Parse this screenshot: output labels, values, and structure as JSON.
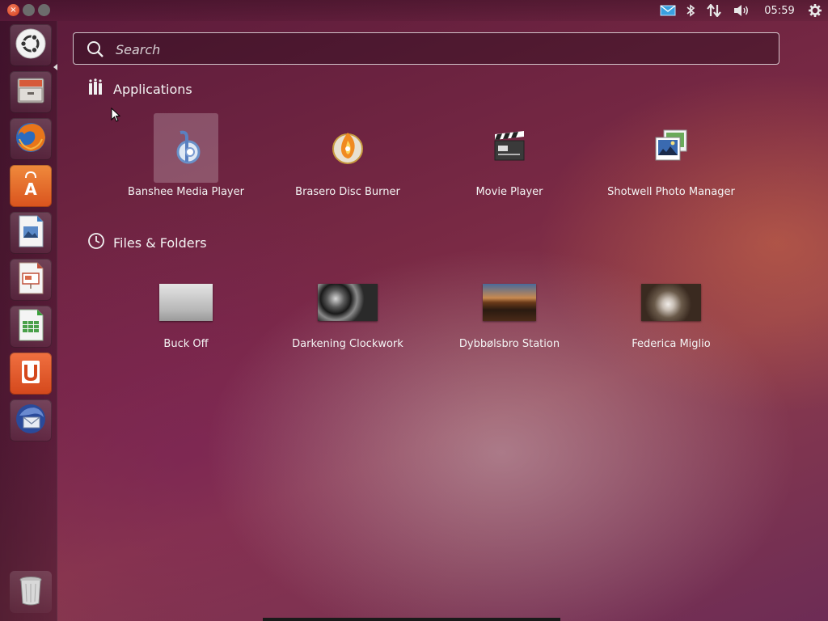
{
  "panel": {
    "clock": "05:59",
    "tray_icons": [
      "mail-icon",
      "bluetooth-icon",
      "network-icon",
      "volume-icon",
      "gear-icon"
    ]
  },
  "launcher": {
    "items": [
      {
        "name": "dash-home",
        "icon": "ubuntu-logo-icon"
      },
      {
        "name": "files",
        "icon": "file-cabinet-icon"
      },
      {
        "name": "firefox",
        "icon": "firefox-icon"
      },
      {
        "name": "software-center",
        "icon": "shopping-bag-icon"
      },
      {
        "name": "libreoffice-writer",
        "icon": "writer-document-icon"
      },
      {
        "name": "libreoffice-impress",
        "icon": "impress-presentation-icon"
      },
      {
        "name": "libreoffice-calc",
        "icon": "calc-spreadsheet-icon"
      },
      {
        "name": "ubuntu-one",
        "icon": "ubuntu-one-icon"
      },
      {
        "name": "thunderbird",
        "icon": "thunderbird-icon"
      }
    ],
    "trash_icon": "trash-icon"
  },
  "search": {
    "placeholder": "Search",
    "value": ""
  },
  "applications": {
    "title": "Applications",
    "items": [
      {
        "label": "Banshee Media Player",
        "icon": "banshee-icon",
        "selected": true
      },
      {
        "label": "Brasero Disc Burner",
        "icon": "brasero-icon",
        "selected": false
      },
      {
        "label": "Movie Player",
        "icon": "clapperboard-icon",
        "selected": false
      },
      {
        "label": "Shotwell Photo Manager",
        "icon": "shotwell-icon",
        "selected": false
      }
    ]
  },
  "files": {
    "title": "Files & Folders",
    "items": [
      {
        "label": "Buck Off"
      },
      {
        "label": "Darkening Clockwork"
      },
      {
        "label": "Dybbølsbro Station"
      },
      {
        "label": "Federica Miglio"
      }
    ]
  },
  "colors": {
    "accent_orange": "#dd4814",
    "panel_text": "#f0f0f0"
  }
}
